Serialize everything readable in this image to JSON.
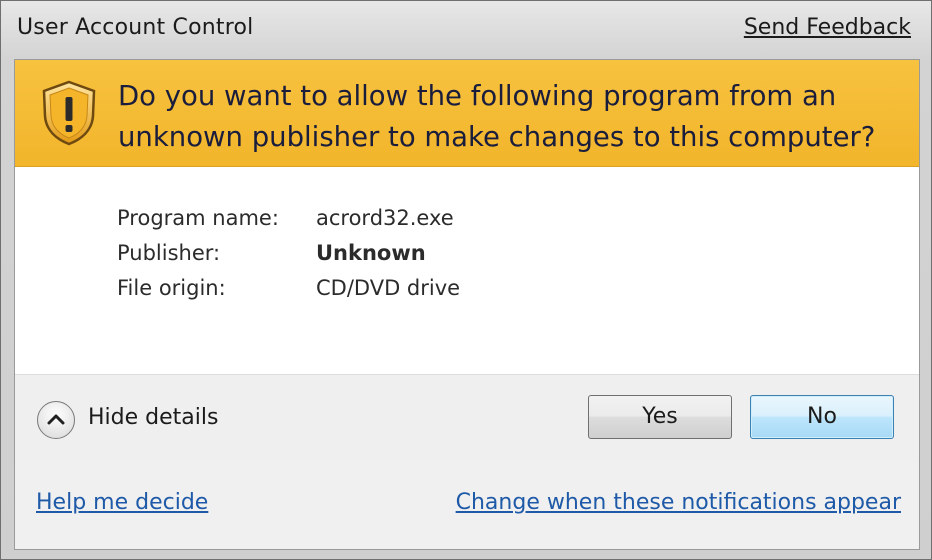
{
  "window": {
    "title": "User Account Control",
    "send_feedback": "Send Feedback"
  },
  "banner": {
    "icon": "uac-shield-warning-icon",
    "question": "Do you want to allow the following program from an unknown publisher to make changes to this computer?",
    "color": "#f5bd37"
  },
  "details": {
    "program_name_label": "Program name:",
    "program_name_value": "acrord32.exe",
    "publisher_label": "Publisher:",
    "publisher_value": "Unknown",
    "file_origin_label": "File origin:",
    "file_origin_value": "CD/DVD drive"
  },
  "controls": {
    "toggle_icon": "chevron-up-icon",
    "hide_details": "Hide details",
    "yes_label": "Yes",
    "no_label": "No"
  },
  "footer": {
    "help_link": "Help me decide",
    "change_link": "Change when these notifications appear",
    "link_color": "#1e5aa8"
  }
}
